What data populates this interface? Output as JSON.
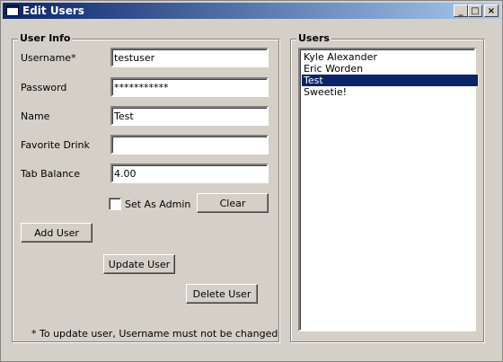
{
  "window": {
    "title": "Edit Users",
    "controls": {
      "minimize": "_",
      "maximize": "□",
      "close": "×"
    }
  },
  "user_info": {
    "legend": "User Info",
    "username": {
      "label": "Username*",
      "value": "testuser"
    },
    "password": {
      "label": "Password",
      "value": "***********"
    },
    "name": {
      "label": "Name",
      "value": "Test"
    },
    "favorite_drink": {
      "label": "Favorite Drink",
      "value": ""
    },
    "tab_balance": {
      "label": "Tab Balance",
      "value": "4.00"
    },
    "set_as_admin": {
      "label": "Set As Admin",
      "checked": false
    },
    "clear_label": "Clear",
    "add_user_label": "Add User",
    "update_user_label": "Update User",
    "delete_user_label": "Delete User",
    "note": "* To update user, Username must not be changed"
  },
  "users": {
    "legend": "Users",
    "items": [
      "Kyle Alexander",
      "Eric Worden",
      "Test",
      "Sweetie!"
    ],
    "selected_index": 2
  }
}
